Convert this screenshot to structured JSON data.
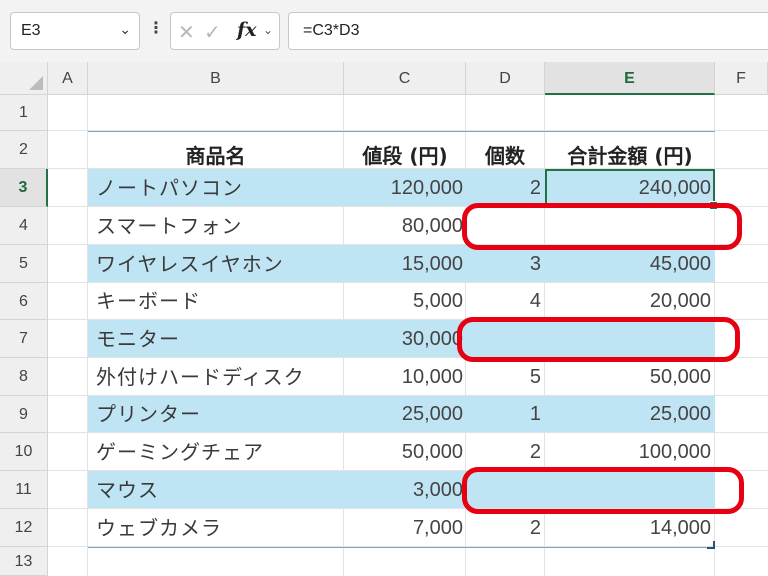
{
  "namebox": {
    "value": "E3",
    "chevron": "chevron-down-icon"
  },
  "formula_bar": {
    "more_icon": "⋮",
    "cancel_icon": "✕",
    "enter_icon": "✓",
    "fx_label": "fx",
    "value": "=C3*D3"
  },
  "columns": [
    "A",
    "B",
    "C",
    "D",
    "E",
    "F"
  ],
  "selected_column": "E",
  "rows": [
    "1",
    "2",
    "3",
    "4",
    "5",
    "6",
    "7",
    "8",
    "9",
    "10",
    "11",
    "12",
    "13"
  ],
  "selected_row": "3",
  "table": {
    "headers": [
      "商品名",
      "値段 (円)",
      "個数",
      "合計金額 (円)"
    ],
    "rows": [
      {
        "name": "ノートパソコン",
        "price": "120,000",
        "qty": "2",
        "total": "240,000"
      },
      {
        "name": "スマートフォン",
        "price": "80,000",
        "qty": "",
        "total": ""
      },
      {
        "name": "ワイヤレスイヤホン",
        "price": "15,000",
        "qty": "3",
        "total": "45,000"
      },
      {
        "name": "キーボード",
        "price": "5,000",
        "qty": "4",
        "total": "20,000"
      },
      {
        "name": "モニター",
        "price": "30,000",
        "qty": "",
        "total": ""
      },
      {
        "name": "外付けハードディスク",
        "price": "10,000",
        "qty": "5",
        "total": "50,000"
      },
      {
        "name": "プリンター",
        "price": "25,000",
        "qty": "1",
        "total": "25,000"
      },
      {
        "name": "ゲーミングチェア",
        "price": "50,000",
        "qty": "2",
        "total": "100,000"
      },
      {
        "name": "マウス",
        "price": "3,000",
        "qty": "",
        "total": ""
      },
      {
        "name": "ウェブカメラ",
        "price": "7,000",
        "qty": "2",
        "total": "14,000"
      }
    ]
  },
  "colors": {
    "band": "#bfe4f4",
    "highlight": "#e60012",
    "selection": "#217346"
  }
}
